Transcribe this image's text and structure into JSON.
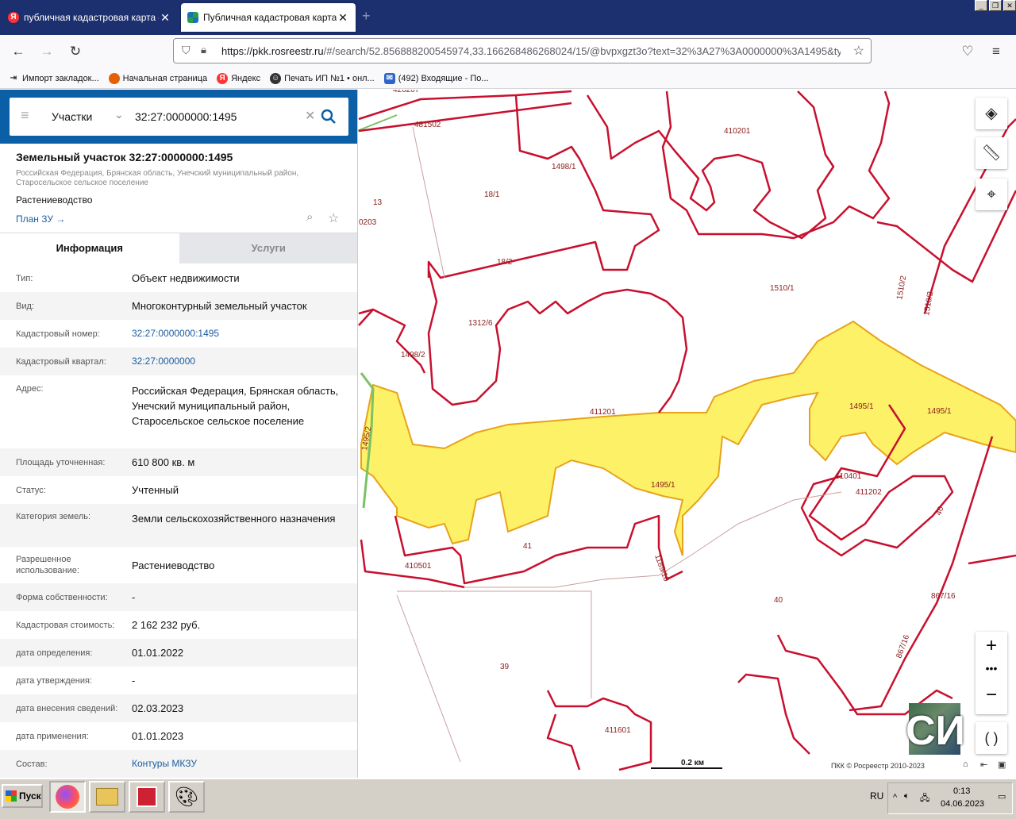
{
  "browser": {
    "tabs": [
      {
        "title": "публичная кадастровая карта — ",
        "active": false
      },
      {
        "title": "Публичная кадастровая карта",
        "active": true
      }
    ],
    "url_host": "https://pkk.rosreestr.ru",
    "url_rest": "/#/search/52.856888200545974,33.166268486268024/15/@bvpxgzt3o?text=32%3A27%3A0000000%3A1495&typ",
    "bookmarks": [
      "Импорт закладок...",
      "Начальная страница",
      "Яндекс",
      "Печать ИП №1 • онл...",
      "(492) Входящие - По..."
    ]
  },
  "search": {
    "category": "Участки",
    "query": "32:27:0000000:1495"
  },
  "parcel": {
    "title": "Земельный участок 32:27:0000000:1495",
    "address_line": "Российская Федерация, Брянская область, Унечский муниципальный район, Старосельское сельское поселение",
    "usage": "Растениеводство",
    "plan_link": "План ЗУ →"
  },
  "tabs": {
    "info": "Информация",
    "services": "Услуги"
  },
  "info_rows": [
    {
      "k": "Тип:",
      "v": "Объект недвижимости"
    },
    {
      "k": "Вид:",
      "v": "Многоконтурный земельный участок"
    },
    {
      "k": "Кадастровый номер:",
      "v": "32:27:0000000:1495"
    },
    {
      "k": "Кадастровый квартал:",
      "v": "32:27:0000000"
    },
    {
      "k": "Адрес:",
      "v": "Российская Федерация, Брянская область, Унечский муниципальный район, Старосельское сельское поселение"
    },
    {
      "k": "Площадь уточненная:",
      "v": "610 800 кв. м"
    },
    {
      "k": "Статус:",
      "v": "Учтенный"
    },
    {
      "k": "Категория земель:",
      "v": "Земли сельскохозяйственного назначения"
    },
    {
      "k": "Разрешенное использование:",
      "v": "Растениеводство"
    },
    {
      "k": "Форма собственности:",
      "v": "-"
    },
    {
      "k": "Кадастровая стоимость:",
      "v": "2 162 232 руб."
    },
    {
      "k": "дата определения:",
      "v": "01.01.2022"
    },
    {
      "k": "дата утверждения:",
      "v": "-"
    },
    {
      "k": "дата внесения сведений:",
      "v": "02.03.2023"
    },
    {
      "k": "дата применения:",
      "v": "01.01.2023"
    },
    {
      "k": "Состав:",
      "v": "Контуры МКЗУ"
    }
  ],
  "map": {
    "labels": [
      "426207",
      "481502",
      "410201",
      "1498/1",
      "18/1",
      "13",
      "0203",
      "18/2",
      "1510/1",
      "1510/2",
      "1510/2",
      "1312/6",
      "1498/2",
      "411201",
      "1495/1",
      "1495/1",
      "1495/2",
      "1495/1",
      "410401",
      "411202",
      "40",
      "1189/10",
      "41",
      "410501",
      "40",
      "867/16",
      "867/16",
      "39",
      "411601"
    ],
    "scale": "0.2 км",
    "copyright": "ПКК © Росреестр 2010-2023",
    "brand": "СИ"
  },
  "taskbar": {
    "start": "Пуск",
    "lang": "RU",
    "time": "0:13",
    "date": "04.06.2023"
  },
  "colors": {
    "accent": "#0a5fa6",
    "parcel_border": "#c8102e",
    "highlight": "#fdf267"
  }
}
